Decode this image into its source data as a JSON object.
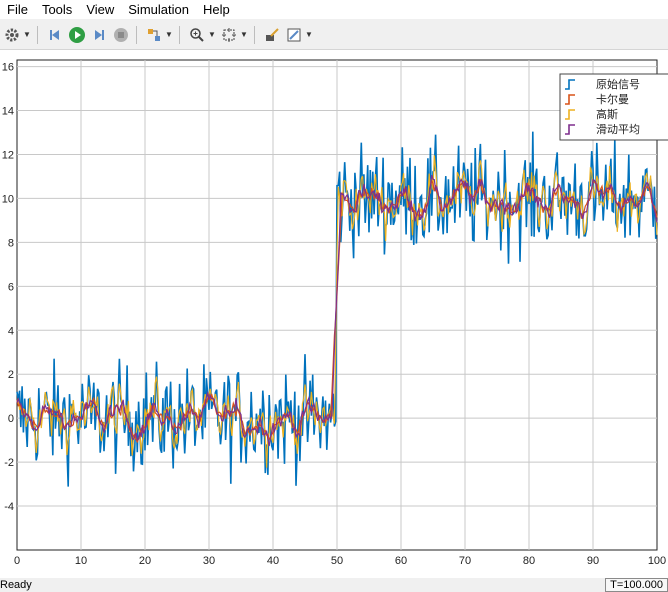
{
  "menu": [
    "File",
    "Tools",
    "View",
    "Simulation",
    "Help"
  ],
  "toolbar": {
    "icons": [
      "settings-icon",
      "step-back-icon",
      "run-icon",
      "step-forward-icon",
      "stop-icon",
      "signal-selector-icon",
      "zoom-icon",
      "fit-to-view-icon",
      "write-data-icon",
      "style-icon"
    ]
  },
  "status": {
    "left": "Ready",
    "right": "T=100.000"
  },
  "chart_data": {
    "type": "line",
    "xlim": [
      0,
      100
    ],
    "ylim": [
      -6,
      16.3
    ],
    "xticks": [
      0,
      10,
      20,
      30,
      40,
      50,
      60,
      70,
      80,
      90,
      100
    ],
    "yticks": [
      -4,
      -2,
      0,
      2,
      4,
      6,
      8,
      10,
      12,
      14,
      16
    ],
    "grid": true,
    "legend_position": "top-right",
    "series": [
      {
        "name": "原始信号",
        "color": "#0072bd",
        "levels": [
          0,
          10
        ],
        "noise": 1.2
      },
      {
        "name": "卡尔曼",
        "color": "#d95319",
        "levels": [
          0,
          10
        ],
        "noise": 0.25
      },
      {
        "name": "高斯",
        "color": "#edb120",
        "levels": [
          0,
          10
        ],
        "noise": 0.6
      },
      {
        "name": "滑动平均",
        "color": "#7e2f8e",
        "levels": [
          0,
          10
        ],
        "noise": 0.2
      }
    ],
    "step_at": 50
  }
}
